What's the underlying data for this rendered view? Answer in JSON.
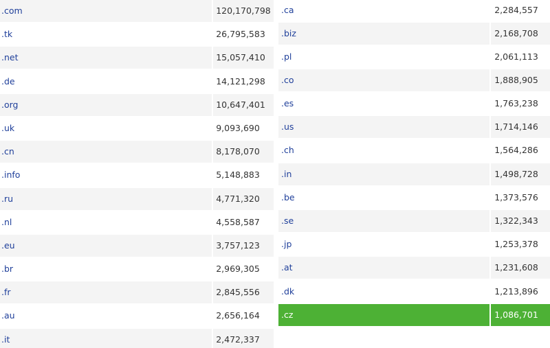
{
  "colors": {
    "link": "#1f3f9a",
    "row_alt": "#f4f4f4",
    "highlight": "#4db135",
    "highlight_text": "#ffffff"
  },
  "left_table": {
    "rows": [
      {
        "domain": ".com",
        "count": "120,170,798"
      },
      {
        "domain": ".tk",
        "count": "26,795,583"
      },
      {
        "domain": ".net",
        "count": "15,057,410"
      },
      {
        "domain": ".de",
        "count": "14,121,298"
      },
      {
        "domain": ".org",
        "count": "10,647,401"
      },
      {
        "domain": ".uk",
        "count": "9,093,690"
      },
      {
        "domain": ".cn",
        "count": "8,178,070"
      },
      {
        "domain": ".info",
        "count": "5,148,883"
      },
      {
        "domain": ".ru",
        "count": "4,771,320"
      },
      {
        "domain": ".nl",
        "count": "4,558,587"
      },
      {
        "domain": ".eu",
        "count": "3,757,123"
      },
      {
        "domain": ".br",
        "count": "2,969,305"
      },
      {
        "domain": ".fr",
        "count": "2,845,556"
      },
      {
        "domain": ".au",
        "count": "2,656,164"
      },
      {
        "domain": ".it",
        "count": "2,472,337"
      }
    ]
  },
  "right_table": {
    "rows": [
      {
        "domain": ".ca",
        "count": "2,284,557"
      },
      {
        "domain": ".biz",
        "count": "2,168,708"
      },
      {
        "domain": ".pl",
        "count": "2,061,113"
      },
      {
        "domain": ".co",
        "count": "1,888,905"
      },
      {
        "domain": ".es",
        "count": "1,763,238"
      },
      {
        "domain": ".us",
        "count": "1,714,146"
      },
      {
        "domain": ".ch",
        "count": "1,564,286"
      },
      {
        "domain": ".in",
        "count": "1,498,728"
      },
      {
        "domain": ".be",
        "count": "1,373,576"
      },
      {
        "domain": ".se",
        "count": "1,322,343"
      },
      {
        "domain": ".jp",
        "count": "1,253,378"
      },
      {
        "domain": ".at",
        "count": "1,231,608"
      },
      {
        "domain": ".dk",
        "count": "1,213,896"
      },
      {
        "domain": ".cz",
        "count": "1,086,701",
        "highlighted": true
      }
    ]
  }
}
